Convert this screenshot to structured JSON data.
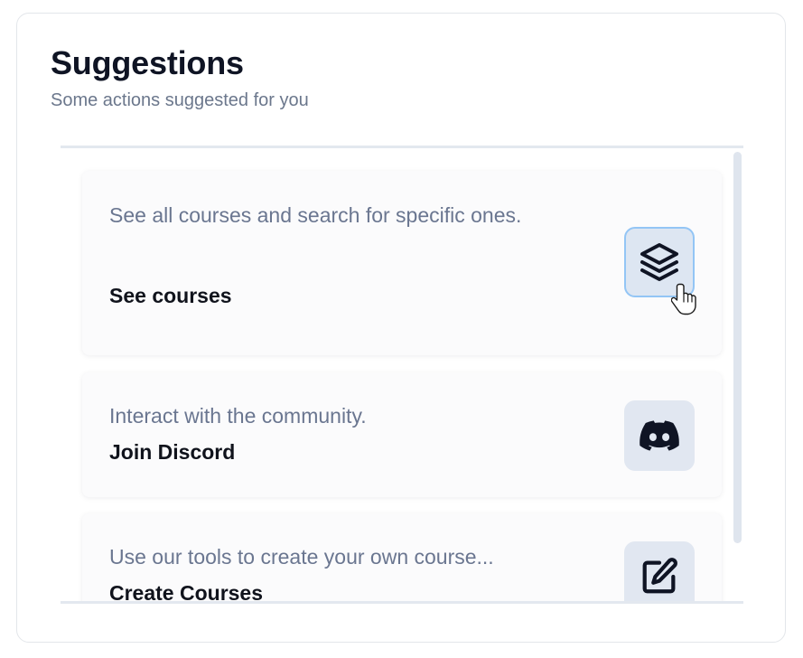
{
  "header": {
    "title": "Suggestions",
    "subtitle": "Some actions suggested for you"
  },
  "suggestions": [
    {
      "description": "See all courses and search for specific ones.",
      "action": "See courses",
      "icon": "layers-icon"
    },
    {
      "description": "Interact with the community.",
      "action": "Join Discord",
      "icon": "discord-icon"
    },
    {
      "description": "Use our tools to create your own course...",
      "action": "Create Courses",
      "icon": "edit-icon"
    }
  ],
  "colors": {
    "title": "#0f1424",
    "muted_text": "#6b778c",
    "icon_button_bg": "#e1e7f1",
    "focus_ring": "#93c5f5"
  }
}
